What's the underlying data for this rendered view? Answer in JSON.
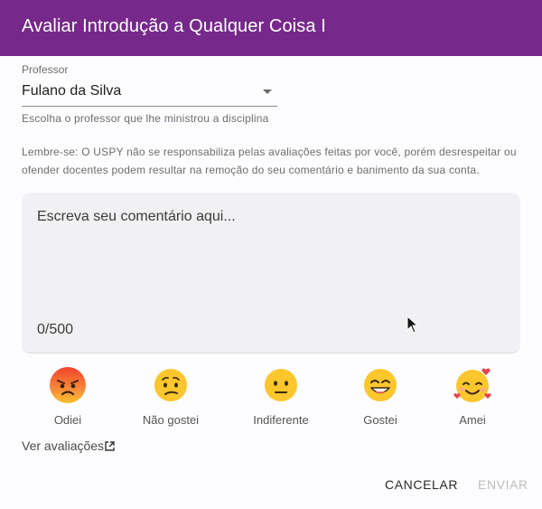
{
  "dialog": {
    "title": "Avaliar Introdução a Qualquer Coisa I",
    "accent_color": "#76298a"
  },
  "professor": {
    "label": "Professor",
    "selected": "Fulano da Silva",
    "helper": "Escolha o professor que lhe ministrou a disciplina"
  },
  "notice": "Lembre-se: O USPY não se responsabiliza pelas avaliações feitas por você, porém desrespeitar ou ofender docentes podem resultar na remoção do seu comentário e banimento da sua conta.",
  "comment": {
    "placeholder": "Escreva seu comentário aqui...",
    "counter": "0/500"
  },
  "ratings": [
    {
      "label": "Odiei",
      "icon": "angry-face-icon"
    },
    {
      "label": "Não gostei",
      "icon": "confused-face-icon"
    },
    {
      "label": "Indiferente",
      "icon": "neutral-face-icon"
    },
    {
      "label": "Gostei",
      "icon": "grinning-face-icon"
    },
    {
      "label": "Amei",
      "icon": "smiling-face-with-hearts-icon"
    }
  ],
  "links": {
    "see_reviews": "Ver avaliações",
    "see_reviews_icon": "external-link-icon"
  },
  "actions": {
    "cancel": "CANCELAR",
    "send": "ENVIAR"
  }
}
